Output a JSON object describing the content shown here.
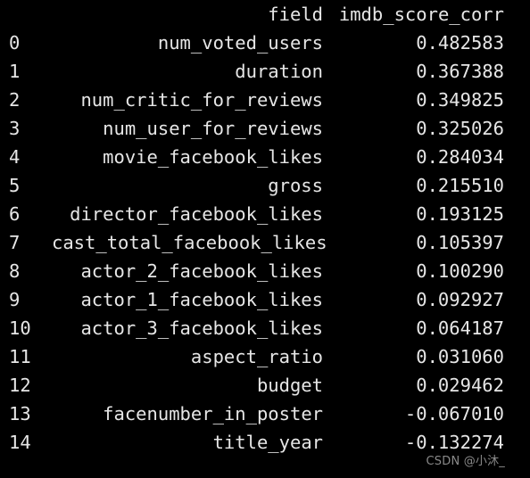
{
  "terminal": {
    "background_color": "#000000",
    "text_color": "#e6e6e6",
    "watermark": "CSDN @小沐_"
  },
  "table": {
    "index_header": "",
    "headers": [
      "field",
      "imdb_score_corr"
    ],
    "rows": [
      {
        "index": "0",
        "field": "num_voted_users",
        "imdb_score_corr": "0.482583"
      },
      {
        "index": "1",
        "field": "duration",
        "imdb_score_corr": "0.367388"
      },
      {
        "index": "2",
        "field": "num_critic_for_reviews",
        "imdb_score_corr": "0.349825"
      },
      {
        "index": "3",
        "field": "num_user_for_reviews",
        "imdb_score_corr": "0.325026"
      },
      {
        "index": "4",
        "field": "movie_facebook_likes",
        "imdb_score_corr": "0.284034"
      },
      {
        "index": "5",
        "field": "gross",
        "imdb_score_corr": "0.215510"
      },
      {
        "index": "6",
        "field": "director_facebook_likes",
        "imdb_score_corr": "0.193125"
      },
      {
        "index": "7",
        "field": "cast_total_facebook_likes",
        "imdb_score_corr": "0.105397"
      },
      {
        "index": "8",
        "field": "actor_2_facebook_likes",
        "imdb_score_corr": "0.100290"
      },
      {
        "index": "9",
        "field": "actor_1_facebook_likes",
        "imdb_score_corr": "0.092927"
      },
      {
        "index": "10",
        "field": "actor_3_facebook_likes",
        "imdb_score_corr": "0.064187"
      },
      {
        "index": "11",
        "field": "aspect_ratio",
        "imdb_score_corr": "0.031060"
      },
      {
        "index": "12",
        "field": "budget",
        "imdb_score_corr": "0.029462"
      },
      {
        "index": "13",
        "field": "facenumber_in_poster",
        "imdb_score_corr": "-0.067010"
      },
      {
        "index": "14",
        "field": "title_year",
        "imdb_score_corr": "-0.132274"
      }
    ]
  },
  "chart_data": {
    "type": "table",
    "title": "",
    "columns": [
      "index",
      "field",
      "imdb_score_corr"
    ],
    "categories": [
      "num_voted_users",
      "duration",
      "num_critic_for_reviews",
      "num_user_for_reviews",
      "movie_facebook_likes",
      "gross",
      "director_facebook_likes",
      "cast_total_facebook_likes",
      "actor_2_facebook_likes",
      "actor_1_facebook_likes",
      "actor_3_facebook_likes",
      "aspect_ratio",
      "budget",
      "facenumber_in_poster",
      "title_year"
    ],
    "values": [
      0.482583,
      0.367388,
      0.349825,
      0.325026,
      0.284034,
      0.21551,
      0.193125,
      0.105397,
      0.10029,
      0.092927,
      0.064187,
      0.03106,
      0.029462,
      -0.06701,
      -0.132274
    ],
    "ylabel": "imdb_score_corr",
    "xlabel": "field",
    "ylim": [
      -0.132274,
      0.482583
    ]
  }
}
